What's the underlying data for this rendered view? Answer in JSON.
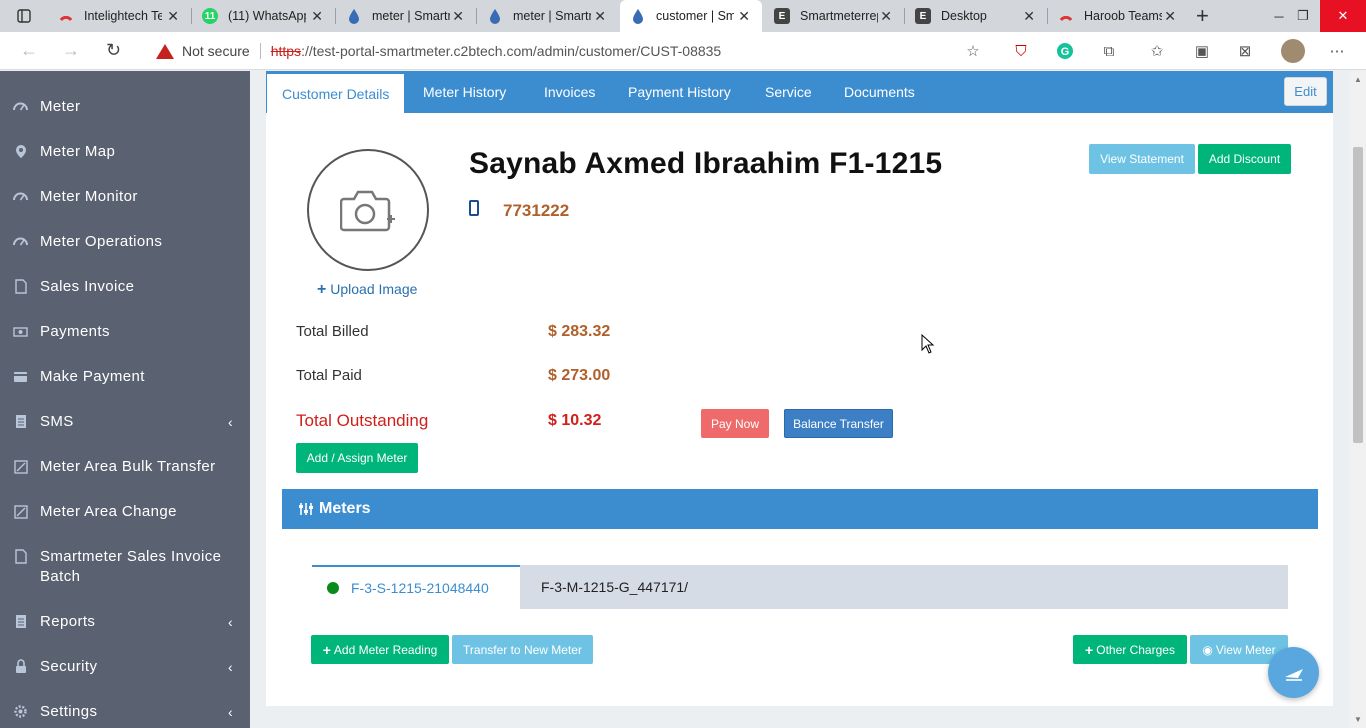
{
  "browser": {
    "tabs": [
      {
        "title": "Intelightech Te",
        "favicon": "C"
      },
      {
        "title": "(11) WhatsApp",
        "favicon": "W"
      },
      {
        "title": "meter | Smartm",
        "favicon": "drop"
      },
      {
        "title": "meter | Smartm",
        "favicon": "drop"
      },
      {
        "title": "customer | Sm",
        "favicon": "drop"
      },
      {
        "title": "Smartmeterrep",
        "favicon": "E"
      },
      {
        "title": "Desktop",
        "favicon": "E"
      },
      {
        "title": "Haroob Teams",
        "favicon": "C"
      }
    ],
    "not_secure": "Not secure",
    "scheme": "https",
    "url": "://test-portal-smartmeter.c2btech.com/admin/customer/CUST-08835"
  },
  "sidebar": {
    "items": [
      {
        "label": "Meter",
        "icon": "meter-icon",
        "chevron": false
      },
      {
        "label": "Meter Map",
        "icon": "map-marker-icon",
        "chevron": false
      },
      {
        "label": "Meter Monitor",
        "icon": "meter-icon",
        "chevron": false
      },
      {
        "label": "Meter Operations",
        "icon": "meter-icon",
        "chevron": false
      },
      {
        "label": "Sales Invoice",
        "icon": "document-icon",
        "chevron": false
      },
      {
        "label": "Payments",
        "icon": "money-icon",
        "chevron": false
      },
      {
        "label": "Make Payment",
        "icon": "credit-card-icon",
        "chevron": false
      },
      {
        "label": "SMS",
        "icon": "sms-icon",
        "chevron": true
      },
      {
        "label": "Meter Area Bulk Transfer",
        "icon": "transfer-icon",
        "chevron": false
      },
      {
        "label": "Meter Area Change",
        "icon": "transfer-icon",
        "chevron": false
      },
      {
        "label": "Smartmeter Sales Invoice Batch",
        "icon": "document-icon",
        "chevron": false
      },
      {
        "label": "Reports",
        "icon": "report-icon",
        "chevron": true
      },
      {
        "label": "Security",
        "icon": "lock-icon",
        "chevron": true
      },
      {
        "label": "Settings",
        "icon": "gear-icon",
        "chevron": true
      }
    ]
  },
  "tabs": {
    "customer_details": "Customer Details",
    "meter_history": "Meter History",
    "invoices": "Invoices",
    "payment_history": "Payment History",
    "service": "Service",
    "documents": "Documents",
    "edit": "Edit"
  },
  "customer": {
    "name": "Saynab Axmed Ibraahim F1-1215",
    "phone": "7731222",
    "upload_image": "Upload Image",
    "total_billed_label": "Total Billed",
    "total_billed": "$ 283.32",
    "total_paid_label": "Total Paid",
    "total_paid": "$ 273.00",
    "total_outstanding_label": "Total Outstanding",
    "total_outstanding": "$ 10.32"
  },
  "actions": {
    "view_statement": "View Statement",
    "add_discount": "Add Discount",
    "pay_now": "Pay Now",
    "balance_transfer": "Balance Transfer",
    "add_assign_meter": "Add / Assign Meter"
  },
  "meters": {
    "heading": "Meters",
    "active_meter": "F-3-S-1215-21048440",
    "other_meter": "F-3-M-1215-G_447171/",
    "add_reading": "Add Meter Reading",
    "transfer": "Transfer to New Meter",
    "other_charges": "Other Charges",
    "view_meter": "View Meter"
  },
  "colors": {
    "primary": "#3c8dd0",
    "sidebar": "#5a6170",
    "success": "#00b57a",
    "info": "#6ec3e4",
    "danger": "#d0201b",
    "amount": "#b0602a"
  }
}
